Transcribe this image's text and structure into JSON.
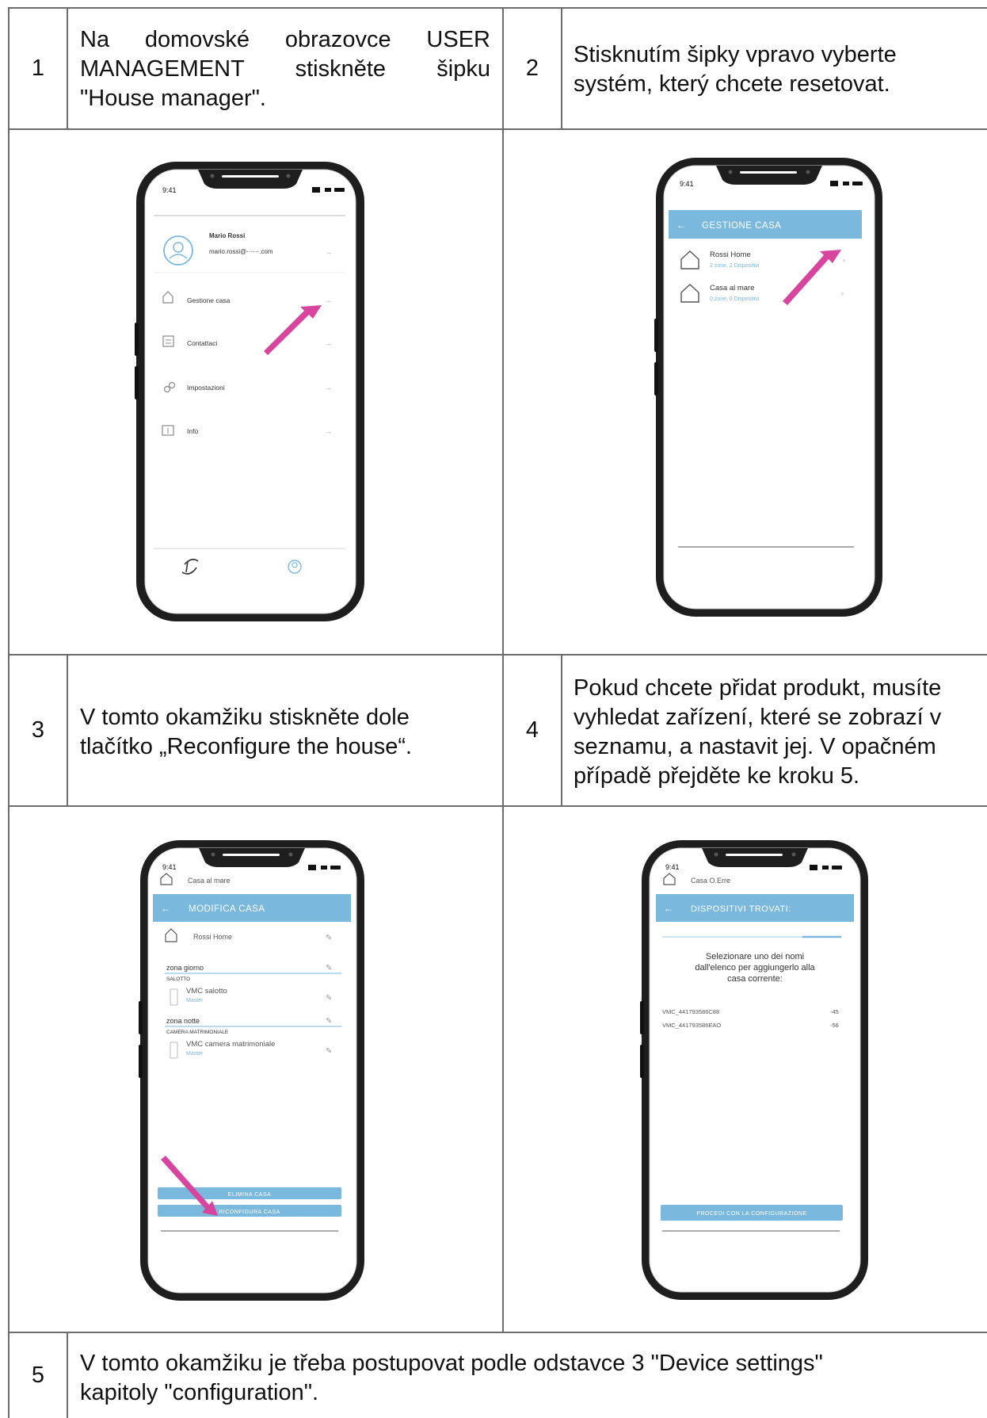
{
  "steps": [
    {
      "num": "1",
      "line1": "Na domovské obrazovce USER",
      "line2": "MANAGEMENT stiskněte šipku",
      "line3": "\"House manager\"."
    },
    {
      "num": "2",
      "line1": "Stisknutím šipky vpravo vyberte",
      "line2": "systém, který chcete resetovat."
    },
    {
      "num": "3",
      "line1": "V tomto okamžiku stiskněte dole",
      "line2": "tlačítko „Reconfigure the house“."
    },
    {
      "num": "4",
      "line1": "Pokud chcete přidat produkt, musíte",
      "line2": "vyhledat zařízení, které se zobrazí v",
      "line3": "seznamu, a nastavit jej. V opačném",
      "line4": "případě přejděte ke kroku 5."
    },
    {
      "num": "5",
      "line1": "V tomto okamžiku je třeba postupovat podle odstavce 3 \"Device settings\"",
      "line2": "kapitoly \"configuration\"."
    }
  ],
  "screen1": {
    "time": "9:41",
    "user_name": "Mario Rossi",
    "user_email": "mario.rossi@······.com",
    "menu": [
      "Gestione casa",
      "Contattaci",
      "Impostazioni",
      "Info"
    ]
  },
  "screen2": {
    "time": "9:41",
    "header": "GESTIONE CASA",
    "houses": [
      {
        "name": "Rossi Home",
        "detail": "2 zone, 2 Dispositivi"
      },
      {
        "name": "Casa al mare",
        "detail": "0 zone, 0 Dispositivi"
      }
    ]
  },
  "screen3": {
    "time": "9:41",
    "house": "Casa al mare",
    "header": "MODIFICA CASA",
    "home_name": "Rossi Home",
    "zone1": "zona giorno",
    "room1": "SALOTTO",
    "device1": "VMC  salotto",
    "device1_role": "Master",
    "zone2": "zona notte",
    "room2": "CAMERA MATRIMONIALE",
    "device2": "VMC  camera matrimoniale",
    "device2_role": "Master",
    "btn_delete": "ELIMINA CASA",
    "btn_reconfigure": "RICONFIGURA CASA"
  },
  "screen4": {
    "time": "9:41",
    "house": "Casa O.Erre",
    "header": "DISPOSITIVI TROVATI:",
    "msg1": "Selezionare uno dei nomi",
    "msg2": "dall'elenco per aggiungerlo alla",
    "msg3": "casa corrente:",
    "devices": [
      {
        "id": "VMC_441793586C88",
        "rssi": "-45"
      },
      {
        "id": "VMC_441793586EAO",
        "rssi": "-56"
      }
    ],
    "btn_proceed": "PROCEDI CON LA CONFIGURAZIONE"
  },
  "colors": {
    "accent": "#7ab8dd",
    "arrow": "#d8459f",
    "frame": "#1e1e1e",
    "grid": "#6b6b6b"
  }
}
